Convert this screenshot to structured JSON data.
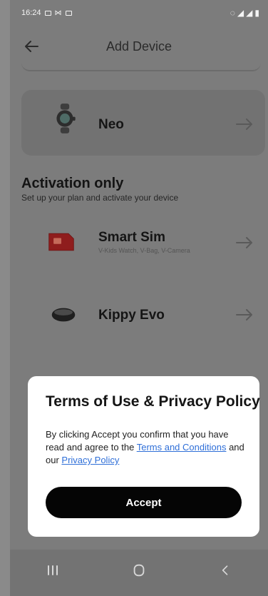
{
  "status_bar": {
    "time": "16:24",
    "left_icons": [
      "message-icon",
      "mail-icon",
      "calendar-icon"
    ],
    "right_icons": [
      "wifi-icon",
      "signal-icon",
      "signal-icon",
      "battery-icon"
    ]
  },
  "header": {
    "title": "Add Device",
    "back_icon": "arrow-left-icon"
  },
  "devices": [
    {
      "name": "Neo",
      "subtitle": "",
      "icon": "watch-icon"
    }
  ],
  "activation": {
    "title": "Activation only",
    "subtitle": "Set up your plan and activate your device",
    "items": [
      {
        "name": "Smart Sim",
        "subtitle": "V-Kids Watch, V-Bag, V-Camera",
        "icon": "sim-card-icon"
      },
      {
        "name": "Kippy Evo",
        "subtitle": "",
        "icon": "tracker-icon"
      }
    ]
  },
  "dialog": {
    "title": "Terms of Use & Privacy Policy",
    "body_prefix": "By clicking Accept you confirm that you have read and agree to the",
    "terms_link": "Terms and Conditions",
    "body_middle": "and our",
    "privacy_link": "Privacy Policy",
    "accept_label": "Accept"
  },
  "navigation": {
    "icons": [
      "recent-apps-icon",
      "home-icon",
      "back-icon"
    ]
  },
  "colors": {
    "overlay_background": "#7c7c7c",
    "dialog_background": "#ffffff",
    "accept_button": "#050505",
    "link": "#2f6fd8"
  }
}
